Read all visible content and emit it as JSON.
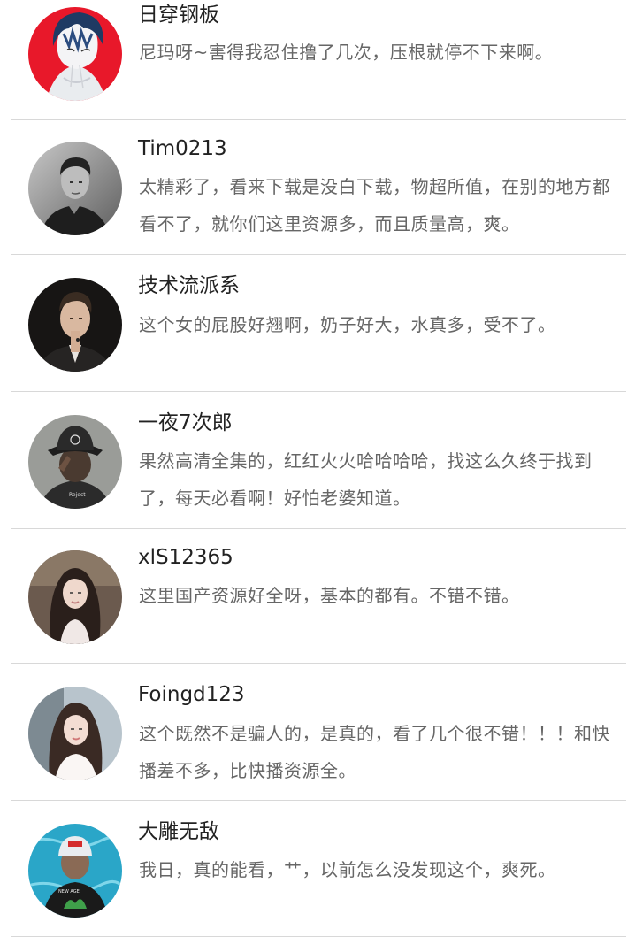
{
  "comments": [
    {
      "username": "日穿钢板",
      "text": "尼玛呀~害得我忍住撸了几次，压根就停不下来啊。",
      "avatar_icon": "anime-boy-avatar-icon",
      "avatar_bg": "#e8182a"
    },
    {
      "username": "Tim0213",
      "text": "太精彩了，看来下载是没白下载，物超所值，在别的地方都看不了，就你们这里资源多，而且质量高，爽。",
      "avatar_icon": "man-portrait-bw-icon",
      "avatar_bg": "#8a8a8a"
    },
    {
      "username": "技术流派系",
      "text": "这个女的屁股好翘啊，奶子好大，水真多，受不了。",
      "avatar_icon": "man-suit-portrait-icon",
      "avatar_bg": "#1a1a1a"
    },
    {
      "username": "一夜7次郎",
      "text": "果然高清全集的，红红火火哈哈哈哈，找这么久终于找到了，每天必看啊！好怕老婆知道。",
      "avatar_icon": "bucket-hat-illustration-icon",
      "avatar_bg": "#9a9c98"
    },
    {
      "username": "xlS12365",
      "text": "这里国产资源好全呀，基本的都有。不错不错。",
      "avatar_icon": "woman-long-hair-avatar-icon",
      "avatar_bg": "#6b5a4e"
    },
    {
      "username": "Foingd123",
      "text": "这个既然不是骗人的，是真的，看了几个很不错！！！和快播差不多，比快播资源全。",
      "avatar_icon": "woman-selfie-avatar-icon",
      "avatar_bg": "#b8c4cc"
    },
    {
      "username": "大雕无敌",
      "text": "我日，真的能看，艹，以前怎么没发现这个，爽死。",
      "avatar_icon": "man-pool-cap-avatar-icon",
      "avatar_bg": "#2aa6c8"
    }
  ]
}
